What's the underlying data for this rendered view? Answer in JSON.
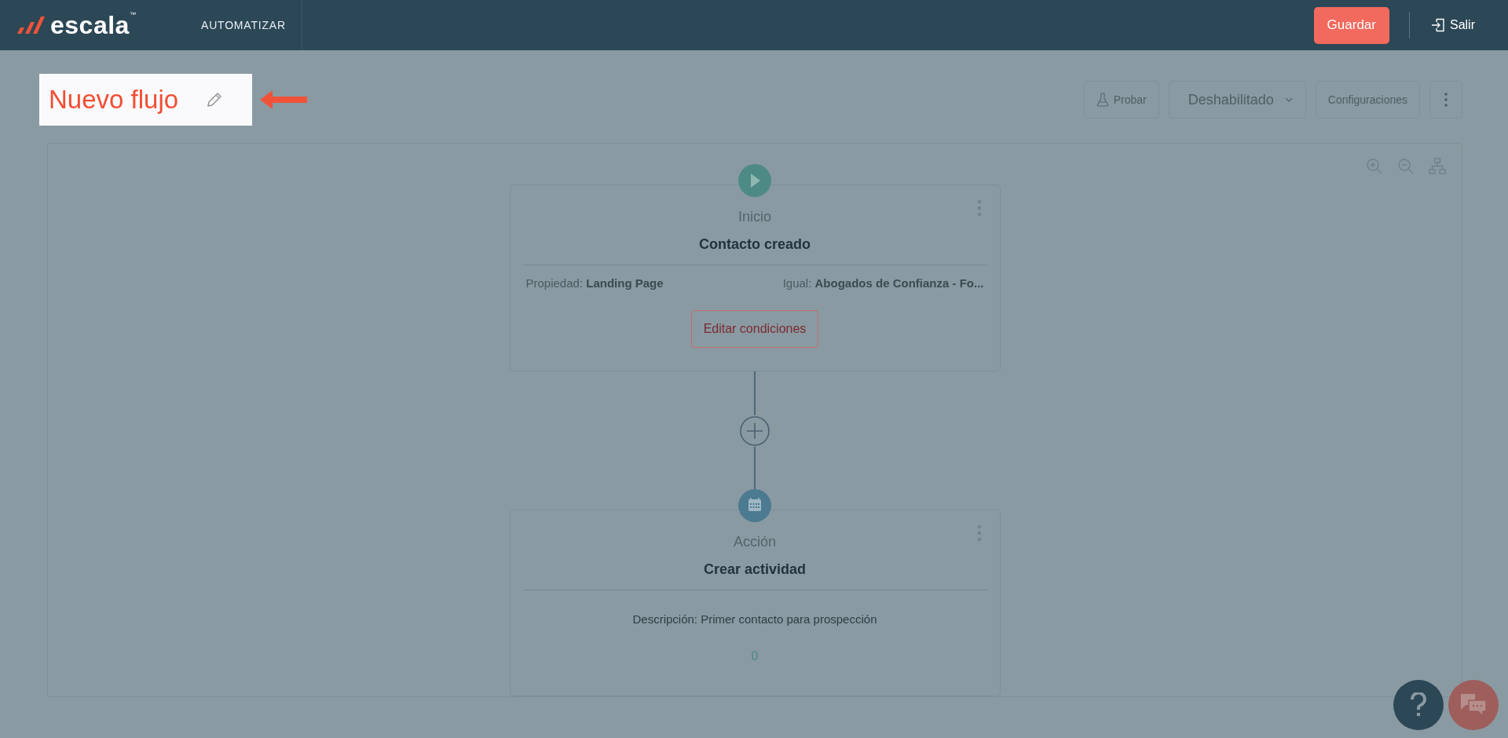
{
  "header": {
    "logo": "escala",
    "logo_mark": "™",
    "nav": [
      {
        "label": "AUTOMATIZAR"
      }
    ],
    "save_button": "Guardar",
    "exit_link": "Salir"
  },
  "title": {
    "text": "Nuevo flujo",
    "highlighted": true
  },
  "toolbar": {
    "test_button": "Probar",
    "status_dropdown": "Deshabilitado",
    "settings_button": "Configuraciones"
  },
  "nodes": [
    {
      "kind": "start",
      "type_label": "Inicio",
      "title": "Contacto creado",
      "conditions": [
        "Propiedad: **Landing Page**",
        "Igual: **Abogados de Confianza - Fo...**"
      ],
      "button": "Editar condiciones"
    },
    {
      "kind": "action",
      "type_label": "Acción",
      "title": "Crear actividad",
      "description": "Descripción: Primer contacto para prospección",
      "count": "0"
    }
  ]
}
